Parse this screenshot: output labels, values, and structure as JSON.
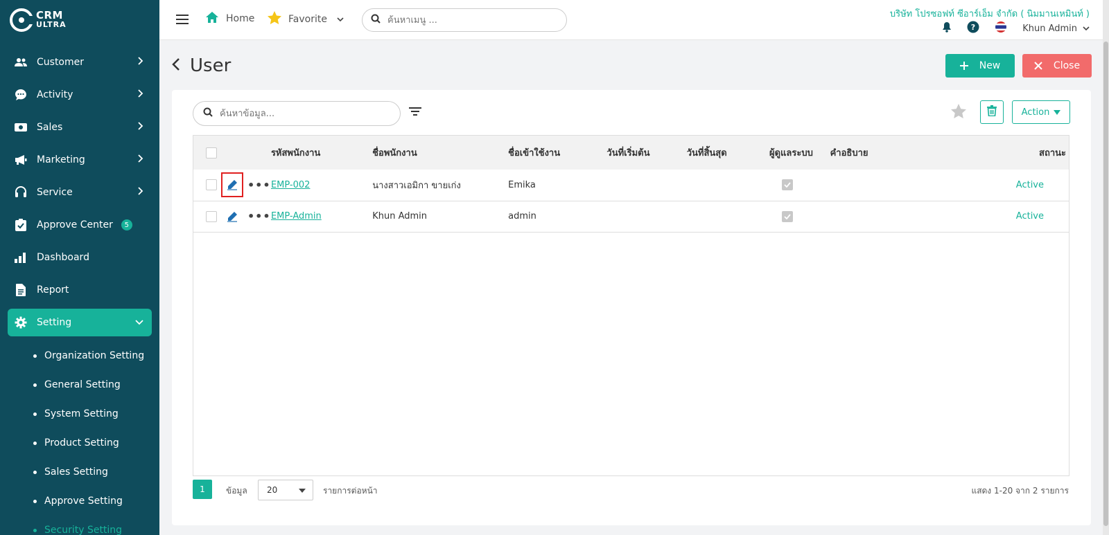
{
  "brand": {
    "line1": "CRM",
    "line2": "ULTRA"
  },
  "sidebar": {
    "items": [
      {
        "label": "Customer",
        "icon": "users-icon"
      },
      {
        "label": "Activity",
        "icon": "chat-icon"
      },
      {
        "label": "Sales",
        "icon": "money-icon"
      },
      {
        "label": "Marketing",
        "icon": "megaphone-icon"
      },
      {
        "label": "Service",
        "icon": "headset-icon"
      },
      {
        "label": "Approve Center",
        "icon": "check-square-icon",
        "badge": "5"
      },
      {
        "label": "Dashboard",
        "icon": "bar-chart-icon"
      },
      {
        "label": "Report",
        "icon": "document-icon"
      },
      {
        "label": "Setting",
        "icon": "gear-icon",
        "active": true
      }
    ],
    "subitems": [
      "Organization Setting",
      "General Setting",
      "System Setting",
      "Product Setting",
      "Sales Setting",
      "Approve Setting",
      "Security Setting"
    ]
  },
  "topbar": {
    "home": "Home",
    "favorite": "Favorite",
    "search_placeholder": "ค้นหาเมนู ...",
    "company": "บริษัท โปรซอฟท์ ซีอาร์เอ็ม จำกัด ( นิมมานเหมินท์ )",
    "user": "Khun Admin"
  },
  "page": {
    "title": "User",
    "new_label": "New",
    "close_label": "Close",
    "search_placeholder": "ค้นหาข้อมูล...",
    "action_label": "Action"
  },
  "table": {
    "columns": [
      "รหัสพนักงาน",
      "ชื่อพนักงาน",
      "ชื่อเข้าใช้งาน",
      "วันที่เริ่มต้น",
      "วันที่สิ้นสุด",
      "ผู้ดูแลระบบ",
      "คำอธิบาย",
      "สถานะ"
    ],
    "rows": [
      {
        "code": "EMP-002",
        "name": "นางสาวเอมิกา ขายเก่ง",
        "username": "Emika",
        "start": "",
        "end": "",
        "admin": true,
        "desc": "",
        "status": "Active"
      },
      {
        "code": "EMP-Admin",
        "name": "Khun Admin",
        "username": "admin",
        "start": "",
        "end": "",
        "admin": true,
        "desc": "",
        "status": "Active"
      }
    ]
  },
  "pager": {
    "page": "1",
    "label": "ข้อมูล",
    "per_page": "20",
    "per_page_label": "รายการต่อหน้า",
    "info": "แสดง 1-20 จาก 2 รายการ"
  },
  "colors": {
    "accent": "#17b29a",
    "sidebar": "#0f4c5c",
    "danger": "#f26b6b",
    "highlight": "#e02020"
  }
}
